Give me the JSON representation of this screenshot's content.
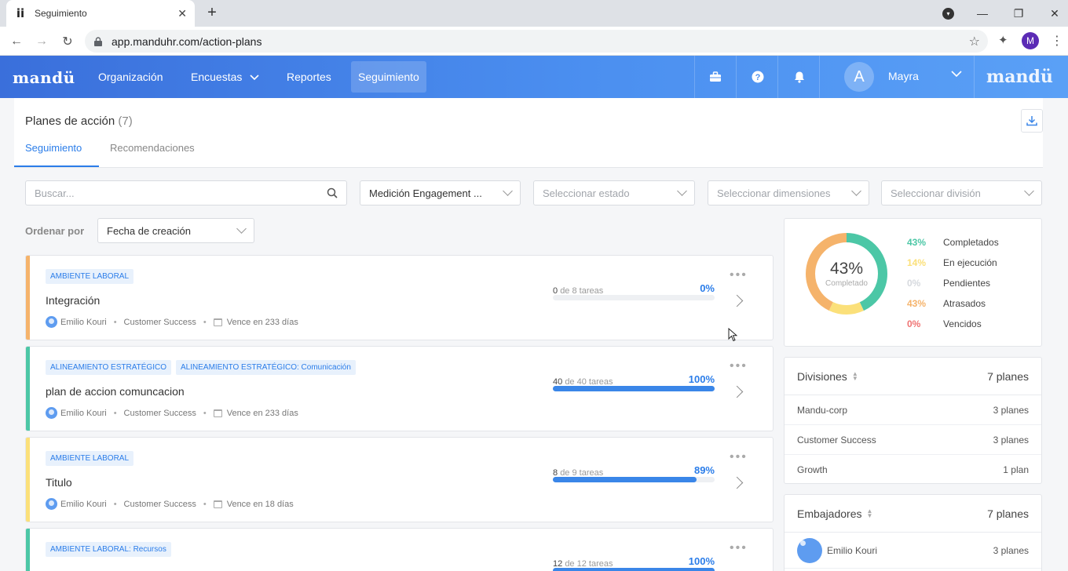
{
  "browser": {
    "tab_title": "Seguimiento",
    "favicon": "ii",
    "url": "app.manduhr.com/action-plans",
    "profile_initial": "M"
  },
  "header": {
    "brand": "mandü",
    "brand_right": "mandü",
    "nav": [
      "Organización",
      "Encuestas",
      "Reportes",
      "Seguimiento"
    ],
    "active_nav": "Seguimiento",
    "avatar_initial": "A",
    "user_name": "Mayra"
  },
  "page": {
    "title": "Planes de acción",
    "count": "(7)",
    "tabs": [
      "Seguimiento",
      "Recomendaciones"
    ]
  },
  "filters": {
    "search_placeholder": "Buscar...",
    "survey": "Medición Engagement ...",
    "state_placeholder": "Seleccionar estado",
    "dimensions_placeholder": "Seleccionar dimensiones",
    "division_placeholder": "Seleccionar división",
    "sort_label": "Ordenar por",
    "sort_value": "Fecha de creación"
  },
  "plans": [
    {
      "tags": [
        "AMBIENTE LABORAL"
      ],
      "title": "Integración",
      "owner": "Emilio Kouri",
      "team": "Customer Success",
      "due": "Vence en 233 días",
      "done": "0",
      "total": "de 8 tareas",
      "percent": "0%",
      "progress": 0,
      "stripe": "#f5b36b"
    },
    {
      "tags": [
        "ALINEAMIENTO ESTRATÉGICO",
        "ALINEAMIENTO ESTRATÉGICO: Comunicación"
      ],
      "title": "plan de accion comuncacion",
      "owner": "Emilio Kouri",
      "team": "Customer Success",
      "due": "Vence en 233 días",
      "done": "40",
      "total": "de 40 tareas",
      "percent": "100%",
      "progress": 100,
      "stripe": "#4cc7a6"
    },
    {
      "tags": [
        "AMBIENTE LABORAL"
      ],
      "title": "Titulo",
      "owner": "Emilio Kouri",
      "team": "Customer Success",
      "due": "Vence en 18 días",
      "done": "8",
      "total": "de 9 tareas",
      "percent": "89%",
      "progress": 89,
      "stripe": "#fbe07a"
    },
    {
      "tags": [
        "AMBIENTE LABORAL: Recursos"
      ],
      "title": "",
      "owner": "",
      "team": "",
      "due": "",
      "done": "12",
      "total": "de 12 tareas",
      "percent": "100%",
      "progress": 100,
      "stripe": "#4cc7a6"
    }
  ],
  "summary": {
    "center_pct": "43%",
    "center_label": "Completado",
    "segments": [
      {
        "pct": "43%",
        "label": "Completados",
        "value": 43,
        "color": "#4cc7a6"
      },
      {
        "pct": "14%",
        "label": "En ejecución",
        "value": 14,
        "color": "#fbe07a"
      },
      {
        "pct": "0%",
        "label": "Pendientes",
        "value": 0,
        "color": "#d6d9de"
      },
      {
        "pct": "43%",
        "label": "Atrasados",
        "value": 43,
        "color": "#f5b36b"
      },
      {
        "pct": "0%",
        "label": "Vencidos",
        "value": 0,
        "color": "#ef7373"
      }
    ]
  },
  "divisions": {
    "title": "Divisiones",
    "total": "7 planes",
    "rows": [
      {
        "name": "Mandu-corp",
        "count": "3 planes"
      },
      {
        "name": "Customer Success",
        "count": "3 planes"
      },
      {
        "name": "Growth",
        "count": "1 plan"
      }
    ]
  },
  "ambassadors": {
    "title": "Embajadores",
    "total": "7 planes",
    "rows": [
      {
        "name": "Emilio Kouri",
        "count": "3 planes"
      }
    ]
  }
}
